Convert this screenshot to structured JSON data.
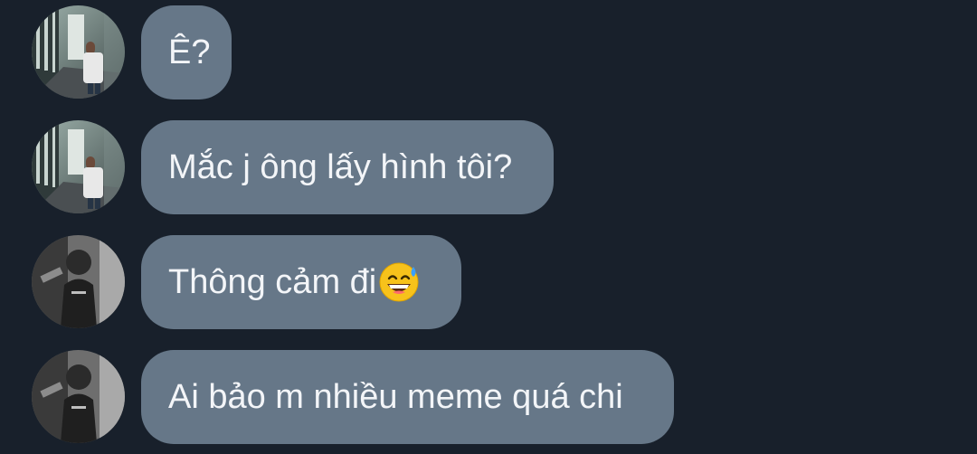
{
  "chat": {
    "messages": [
      {
        "text": "Ê?",
        "avatar": "avatar-hallway-photo",
        "emoji": null
      },
      {
        "text": "Mắc j ông lấy hình tôi?",
        "avatar": "avatar-hallway-photo",
        "emoji": null
      },
      {
        "text": "Thông cảm đi",
        "avatar": "avatar-monochrome-photo",
        "emoji": "grinning-face-with-sweat-emoji"
      },
      {
        "text": "Ai bảo m nhiều meme quá chi",
        "avatar": "avatar-monochrome-photo",
        "emoji": null
      }
    ]
  },
  "colors": {
    "background": "#18202b",
    "bubble": "#667788",
    "text": "#f3f5f8"
  }
}
